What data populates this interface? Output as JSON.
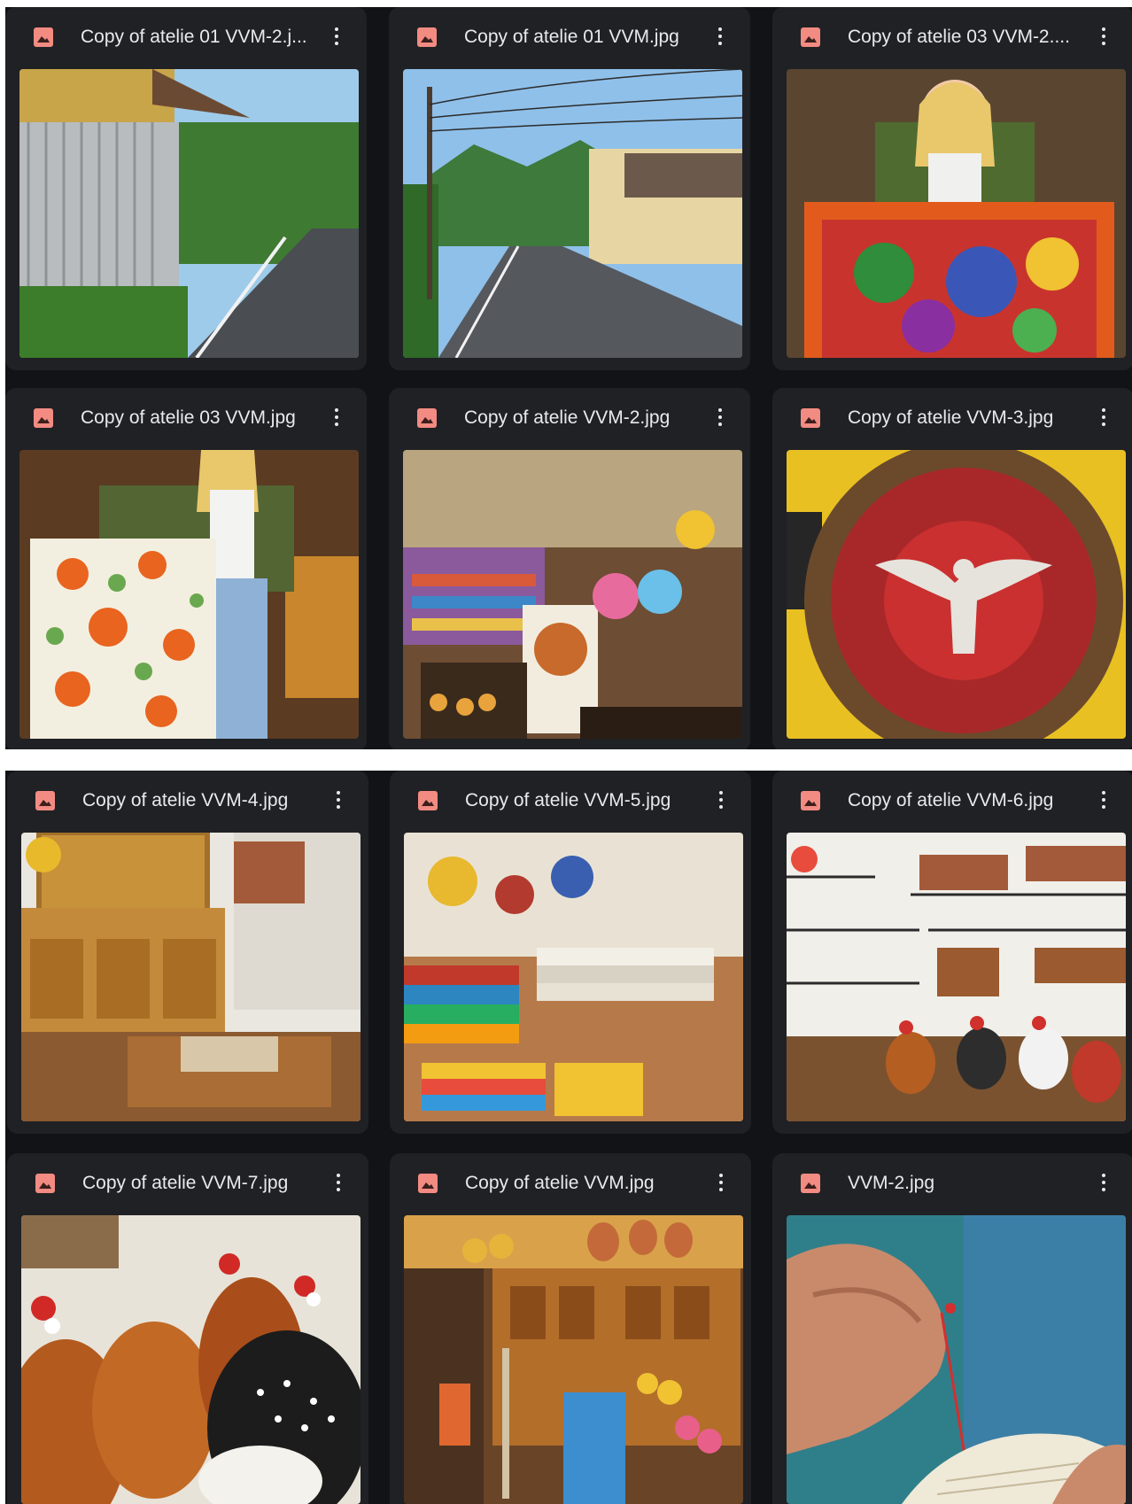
{
  "files": [
    {
      "name": "Copy of atelie 01 VVM-2.j...",
      "thumb_alt": "street-with-corrugated-wall"
    },
    {
      "name": "Copy of atelie 01 VVM.jpg",
      "thumb_alt": "road-with-power-lines-and-house"
    },
    {
      "name": "Copy of atelie 03 VVM-2....",
      "thumb_alt": "woman-holding-colorful-tapestry"
    },
    {
      "name": "Copy of atelie 03 VVM.jpg",
      "thumb_alt": "woman-holding-floral-rug"
    },
    {
      "name": "Copy of atelie VVM-2.jpg",
      "thumb_alt": "craft-shop-interior"
    },
    {
      "name": "Copy of atelie VVM-3.jpg",
      "thumb_alt": "dove-on-red-round-panel"
    },
    {
      "name": "Copy of atelie VVM-4.jpg",
      "thumb_alt": "wooden-cabinet-room"
    },
    {
      "name": "Copy of atelie VVM-5.jpg",
      "thumb_alt": "stacked-textiles"
    },
    {
      "name": "Copy of atelie VVM-6.jpg",
      "thumb_alt": "shelves-with-ceramic-chickens"
    },
    {
      "name": "Copy of atelie VVM-7.jpg",
      "thumb_alt": "painted-gourd-chickens"
    },
    {
      "name": "Copy of atelie VVM.jpg",
      "thumb_alt": "wooden-hutch-with-pottery"
    },
    {
      "name": "VVM-2.jpg",
      "thumb_alt": "hands-embroidering-thread"
    }
  ],
  "icons": {
    "file_type": "image-file-icon",
    "menu": "more-vert-icon"
  },
  "colors": {
    "card_bg": "#202124",
    "panel_bg": "#121316",
    "icon_red": "#f28b82",
    "text": "#e8eaed"
  }
}
